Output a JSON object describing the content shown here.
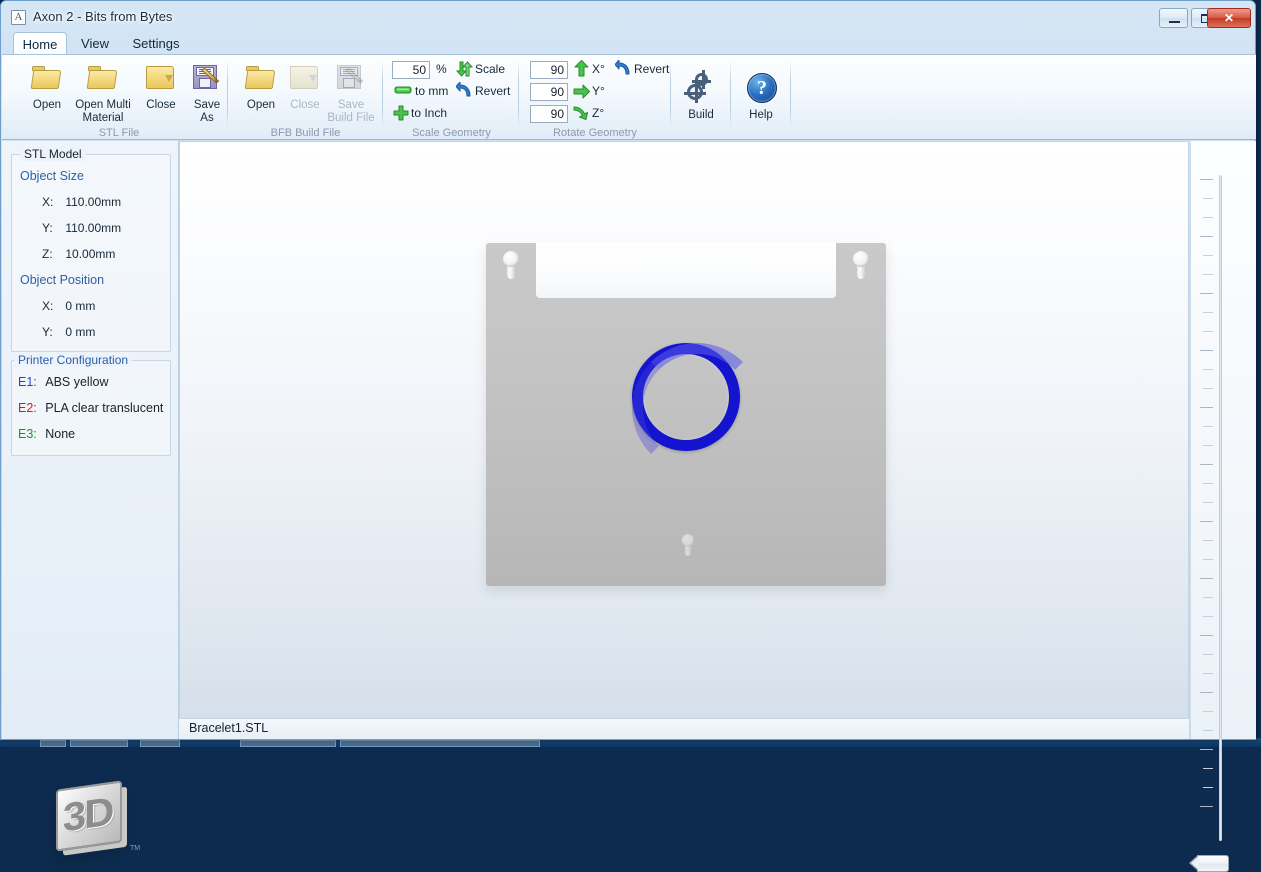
{
  "window": {
    "title": "Axon 2 - Bits from Bytes",
    "app_icon": "axon-logo-icon",
    "minimize_label": "Minimize",
    "maximize_label": "Maximize",
    "close_label": "Close"
  },
  "tabs": [
    {
      "label": "Home",
      "active": true
    },
    {
      "label": "View",
      "active": false
    },
    {
      "label": "Settings",
      "active": false
    }
  ],
  "ribbon": {
    "groups": [
      {
        "name": "stl-file",
        "label": "STL File",
        "buttons": [
          {
            "label": "Open",
            "icon": "folder-open-icon",
            "enabled": true
          },
          {
            "label": "Open Multi\nMaterial",
            "line1": "Open Multi",
            "line2": "Material",
            "icon": "folder-open-icon",
            "enabled": true
          },
          {
            "label": "Close",
            "icon": "folder-close-icon",
            "enabled": true
          },
          {
            "label": "Save\nAs",
            "line1": "Save",
            "line2": "As",
            "icon": "save-as-icon",
            "enabled": true
          }
        ]
      },
      {
        "name": "bfb-build-file",
        "label": "BFB Build File",
        "buttons": [
          {
            "label": "Open",
            "icon": "folder-open-icon",
            "enabled": true
          },
          {
            "label": "Close",
            "icon": "folder-close-icon",
            "enabled": false
          },
          {
            "label": "Save\nBuild File",
            "line1": "Save",
            "line2": "Build File",
            "icon": "save-build-file-icon",
            "enabled": false
          }
        ]
      },
      {
        "name": "scale-geometry",
        "label": "Scale Geometry",
        "percent_value": "50",
        "percent_symbol": "%",
        "scale_label": "Scale",
        "scale_icon": "scale-updown-arrows-icon",
        "to_mm_label": "to mm",
        "to_mm_icon": "to-mm-icon",
        "revert_label": "Revert",
        "revert_icon": "revert-arrow-icon",
        "to_inch_label": "to Inch",
        "to_inch_icon": "to-inch-plus-icon"
      },
      {
        "name": "rotate-geometry",
        "label": "Rotate Geometry",
        "x_value": "90",
        "x_label": "X°",
        "x_icon": "arrow-up-icon",
        "y_value": "90",
        "y_label": "Y°",
        "y_icon": "arrow-right-icon",
        "z_value": "90",
        "z_label": "Z°",
        "z_icon": "arrow-curve-down-icon",
        "revert_label": "Revert",
        "revert_icon": "revert-arrow-icon"
      },
      {
        "name": "build",
        "label": "",
        "buttons": [
          {
            "label": "Build",
            "icon": "gears-icon",
            "enabled": true
          }
        ]
      },
      {
        "name": "help",
        "label": "",
        "buttons": [
          {
            "label": "Help",
            "icon": "help-question-icon",
            "enabled": true
          }
        ]
      }
    ]
  },
  "sidebar": {
    "stl_model": {
      "legend": "STL Model",
      "object_size_header": "Object Size",
      "size_rows": [
        {
          "axis": "X:",
          "value": "110.00mm"
        },
        {
          "axis": "Y:",
          "value": "110.00mm"
        },
        {
          "axis": "Z:",
          "value": "10.00mm"
        }
      ],
      "object_position_header": "Object Position",
      "position_rows": [
        {
          "axis": "X:",
          "value": "0 mm"
        },
        {
          "axis": "Y:",
          "value": "0 mm"
        }
      ]
    },
    "printer_configuration": {
      "legend": "Printer Configuration",
      "extruders": [
        {
          "slot": "E1:",
          "material": "ABS yellow",
          "color": "#2b3fd8"
        },
        {
          "slot": "E2:",
          "material": "PLA clear translucent",
          "color": "#e01414"
        },
        {
          "slot": "E3:",
          "material": "None",
          "color": "#179c17"
        }
      ]
    },
    "logo": {
      "text": "3D",
      "trademark": "TM",
      "name": "bits-from-bytes-3d-logo"
    }
  },
  "viewport": {
    "name": "3d-model-viewport",
    "bed_name": "print-bed-platform",
    "model_name": "bracelet-torus-model",
    "model_color": "#1414cf",
    "bed_color": "#c2c2c2"
  },
  "slider": {
    "name": "layer-height-slider",
    "orientation": "vertical",
    "thumb_position": "bottom"
  },
  "statusbar": {
    "filename": "Bracelet1.STL"
  },
  "colors": {
    "accent_blue": "#2b5fa8",
    "ribbon_bg": "#f4f9fd",
    "window_chrome": "#c3dcf0",
    "group_label": "#8a9bad"
  }
}
